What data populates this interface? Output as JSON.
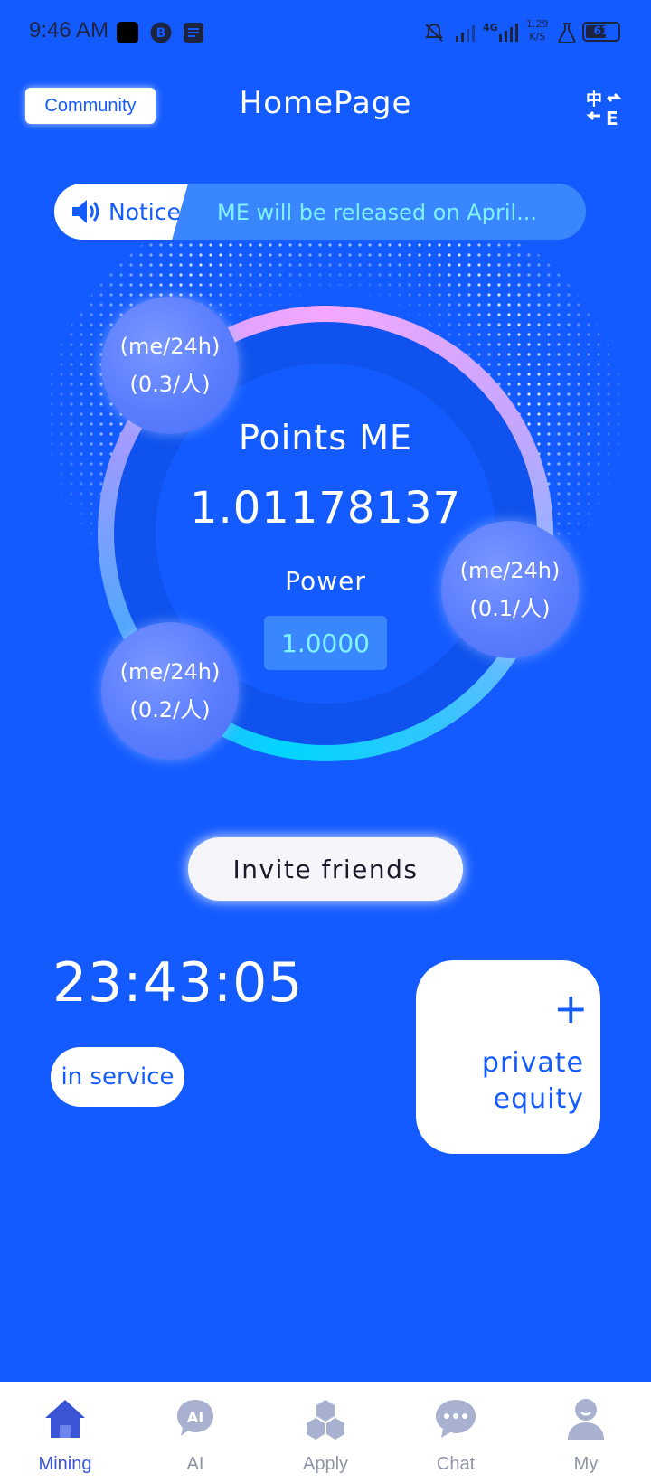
{
  "status_bar": {
    "time": "9:46 AM",
    "network_speed_value": "1.29",
    "network_speed_unit": "K/S",
    "battery": "61",
    "network_type": "4G"
  },
  "header": {
    "community_label": "Community",
    "title": "HomePage"
  },
  "notice": {
    "label": "Notice",
    "text": "ME will be released on April..."
  },
  "dashboard": {
    "points_label": "Points ME",
    "points_value": "1.01178137",
    "power_label": "Power",
    "power_value": "1.0000",
    "bubbles": [
      {
        "rate": "(me/24h)",
        "share": "(0.3/人)"
      },
      {
        "rate": "(me/24h)",
        "share": "(0.1/人)"
      },
      {
        "rate": "(me/24h)",
        "share": "(0.2/人)"
      }
    ]
  },
  "actions": {
    "invite_label": "Invite friends",
    "timer": "23:43:05",
    "service_status": "in service",
    "equity_plus": "+",
    "equity_line1": "private",
    "equity_line2": "equity"
  },
  "bottom_nav": {
    "items": [
      {
        "label": "Mining",
        "icon": "home-icon",
        "active": true
      },
      {
        "label": "AI",
        "icon": "ai-icon",
        "active": false
      },
      {
        "label": "Apply",
        "icon": "apps-icon",
        "active": false
      },
      {
        "label": "Chat",
        "icon": "chat-icon",
        "active": false
      },
      {
        "label": "My",
        "icon": "user-icon",
        "active": false
      }
    ]
  },
  "colors": {
    "background": "#145bff",
    "accent_cyan": "#7ff3ff",
    "nav_active": "#3a55d6",
    "nav_inactive": "#8f95a6"
  }
}
